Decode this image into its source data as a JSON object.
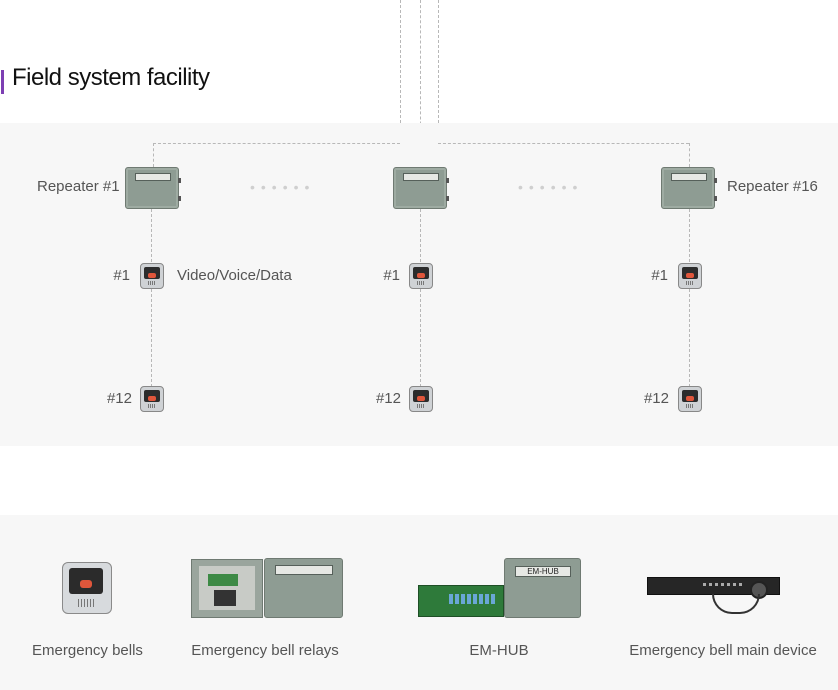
{
  "section": {
    "title": "Field system facility"
  },
  "diagram": {
    "repeater_left_label": "Repeater #1",
    "repeater_right_label": "Repeater #16",
    "link_label": "Video/Voice/Data",
    "bell_first_label": "#1",
    "bell_last_label": "#12",
    "ellipsis": "••••••"
  },
  "devices": [
    {
      "caption": "Emergency bells",
      "icon": "emergency-bell-icon"
    },
    {
      "caption": "Emergency bell relays",
      "icon": "relay-box-icon"
    },
    {
      "caption": "EM-HUB",
      "icon": "em-hub-icon",
      "panel_text": "EM-HUB"
    },
    {
      "caption": "Emergency bell main device",
      "icon": "main-device-icon"
    }
  ],
  "colors": {
    "accent": "#7d3fb3",
    "panel_bg": "#f7f7f7",
    "enclosure": "#8e9c93",
    "bell_button": "#e0563b"
  }
}
